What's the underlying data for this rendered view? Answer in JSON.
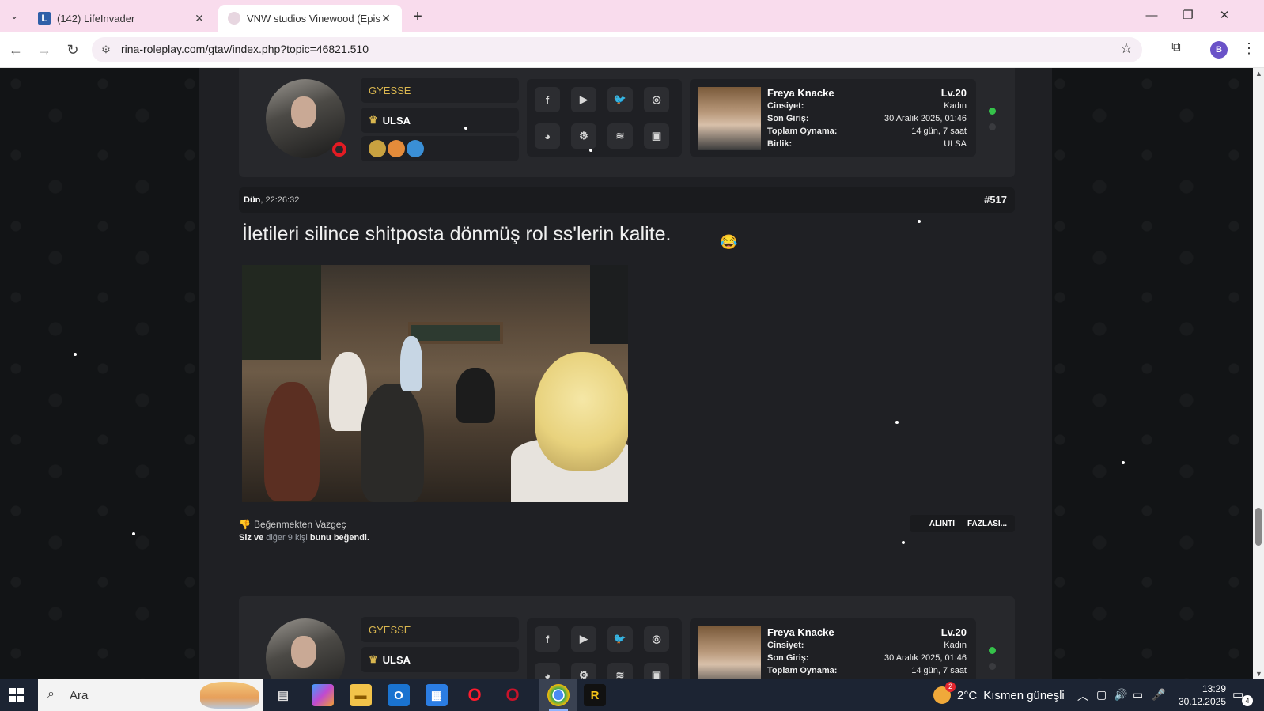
{
  "browser": {
    "tabs": [
      {
        "title": "(142) LifeInvader",
        "favicon": "lifeinvader-icon"
      },
      {
        "title": "VNW studios Vinewood (Episode",
        "favicon": "vnw-icon"
      }
    ],
    "url": "rina-roleplay.com/gtav/index.php?topic=46821.510",
    "profile_initial": "B"
  },
  "forum": {
    "posts_top": {
      "rank": "GYESSE",
      "faction": "ULSA",
      "character": {
        "name": "Freya Knacke",
        "level": "Lv.20",
        "rows": [
          {
            "k": "Cinsiyet:",
            "v": "Kadın"
          },
          {
            "k": "Son Giriş:",
            "v": "30 Aralık 2025, 01:46"
          },
          {
            "k": "Toplam Oynama:",
            "v": "14 gün, 7 saat"
          },
          {
            "k": "Birlik:",
            "v": "ULSA"
          }
        ]
      }
    },
    "post": {
      "date_day": "Dün",
      "date_time": ", 22:26:32",
      "number": "#517",
      "text": "İletileri silince shitposta dönmüş rol ss'lerin kalite.",
      "emoji": "😂",
      "unlike_label": "Beğenmekten Vazgeç",
      "likes_prefix": "Siz ve",
      "likes_link": "diğer 9 kişi",
      "likes_suffix": "bunu beğendi.",
      "quote_label": "ALINTI",
      "more_label": "FAZLASI..."
    },
    "posts_bottom": {
      "rank": "GYESSE",
      "faction": "ULSA",
      "character": {
        "name": "Freya Knacke",
        "level": "Lv.20",
        "rows": [
          {
            "k": "Cinsiyet:",
            "v": "Kadın"
          },
          {
            "k": "Son Giriş:",
            "v": "30 Aralık 2025, 01:46"
          },
          {
            "k": "Toplam Oynama:",
            "v": "14 gün, 7 saat"
          }
        ]
      }
    }
  },
  "taskbar": {
    "search_placeholder": "Ara",
    "weather_temp": "2°C",
    "weather_text": "Kısmen güneşli",
    "weather_badge": "2",
    "time": "13:29",
    "date": "30.12.2025",
    "notification_count": "4"
  },
  "colors": {
    "tabbar": "#f9dced",
    "accent_gold": "#d9b64f",
    "online_green": "#35c24a",
    "taskbar": "#1c2433"
  }
}
